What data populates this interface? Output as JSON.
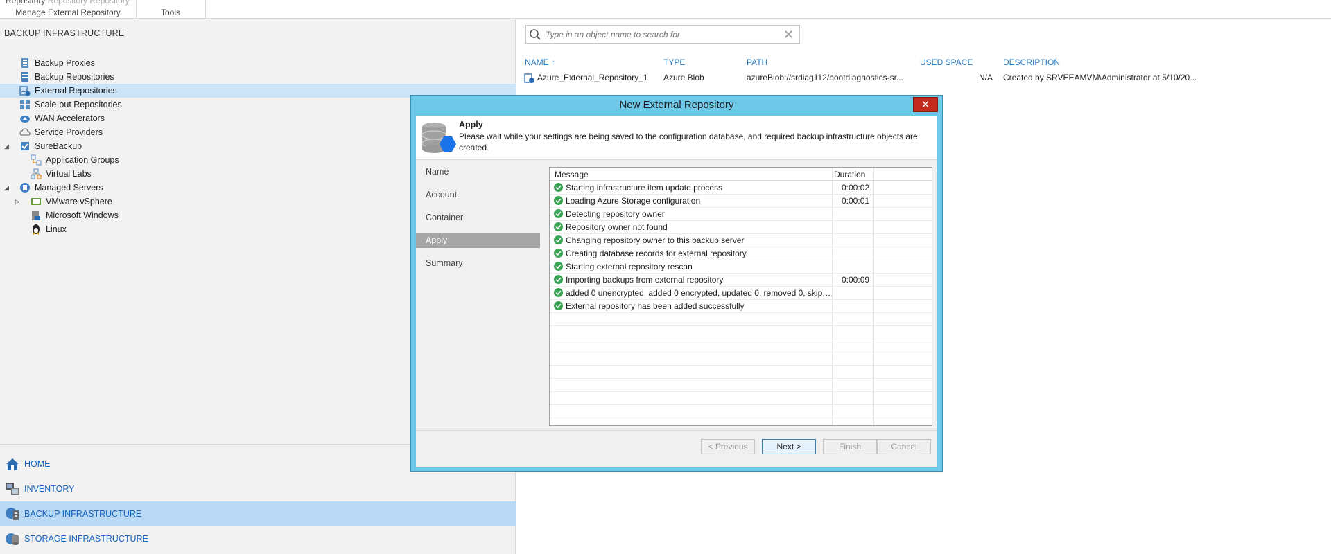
{
  "ribbon": {
    "top_text_main": "Repository",
    "top_text_dim": "Repository   Repository",
    "group1": "Manage External Repository",
    "group2": "Tools"
  },
  "left_panel": {
    "title": "BACKUP INFRASTRUCTURE",
    "tree": [
      {
        "label": "Backup Proxies",
        "icon": "backup-proxy-icon"
      },
      {
        "label": "Backup Repositories",
        "icon": "repository-icon"
      },
      {
        "label": "External Repositories",
        "icon": "external-repository-icon",
        "selected": true
      },
      {
        "label": "Scale-out Repositories",
        "icon": "scaleout-icon"
      },
      {
        "label": "WAN Accelerators",
        "icon": "wan-icon"
      },
      {
        "label": "Service Providers",
        "icon": "cloud-provider-icon"
      },
      {
        "label": "SureBackup",
        "icon": "surebackup-icon"
      },
      {
        "label": "Application Groups",
        "icon": "app-group-icon"
      },
      {
        "label": "Virtual Labs",
        "icon": "virtual-lab-icon"
      },
      {
        "label": "Managed Servers",
        "icon": "managed-servers-icon"
      },
      {
        "label": "VMware vSphere",
        "icon": "vsphere-icon"
      },
      {
        "label": "Microsoft Windows",
        "icon": "windows-icon"
      },
      {
        "label": "Linux",
        "icon": "linux-icon"
      }
    ],
    "nav": [
      {
        "label": "HOME",
        "icon": "home-icon"
      },
      {
        "label": "INVENTORY",
        "icon": "inventory-icon"
      },
      {
        "label": "BACKUP INFRASTRUCTURE",
        "icon": "backup-infrastructure-icon",
        "active": true
      },
      {
        "label": "STORAGE INFRASTRUCTURE",
        "icon": "storage-icon"
      }
    ]
  },
  "search": {
    "placeholder": "Type in an object name to search for"
  },
  "grid": {
    "columns": [
      "NAME",
      "TYPE",
      "PATH",
      "USED SPACE",
      "DESCRIPTION"
    ],
    "sort_indicator": "↑",
    "row": {
      "name": "Azure_External_Repository_1",
      "type": "Azure Blob",
      "path": "azureBlob://srdiag112/bootdiagnostics-sr...",
      "used_space": "N/A",
      "description": "Created by SRVEEAMVM\\Administrator at 5/10/20..."
    }
  },
  "dialog": {
    "title": "New External Repository",
    "close": "✕",
    "header_title": "Apply",
    "header_desc": "Please wait while your settings are being saved to the configuration database, and required backup infrastructure objects are created.",
    "steps": [
      "Name",
      "Account",
      "Container",
      "Apply",
      "Summary"
    ],
    "current_step": "Apply",
    "log_columns": {
      "message": "Message",
      "duration": "Duration"
    },
    "log": [
      {
        "message": "Starting infrastructure item update process",
        "duration": "0:00:02"
      },
      {
        "message": "Loading Azure Storage configuration",
        "duration": "0:00:01"
      },
      {
        "message": "Detecting repository owner",
        "duration": ""
      },
      {
        "message": "Repository owner not found",
        "duration": ""
      },
      {
        "message": "Changing repository owner to this backup server",
        "duration": ""
      },
      {
        "message": "Creating database records for external repository",
        "duration": ""
      },
      {
        "message": "Starting external repository rescan",
        "duration": ""
      },
      {
        "message": "Importing backups from external repository",
        "duration": "0:00:09"
      },
      {
        "message": "added 0 unencrypted, added 0 encrypted, updated 0, removed 0, skipp...",
        "duration": ""
      },
      {
        "message": "External repository has been added successfully",
        "duration": ""
      }
    ],
    "buttons": {
      "previous": "< Previous",
      "next": "Next >",
      "finish": "Finish",
      "cancel": "Cancel"
    }
  },
  "colors": {
    "accent": "#1565c0",
    "selection": "#cce4f7",
    "dialog_frame": "#6ec8e8",
    "success": "#3aa655"
  }
}
